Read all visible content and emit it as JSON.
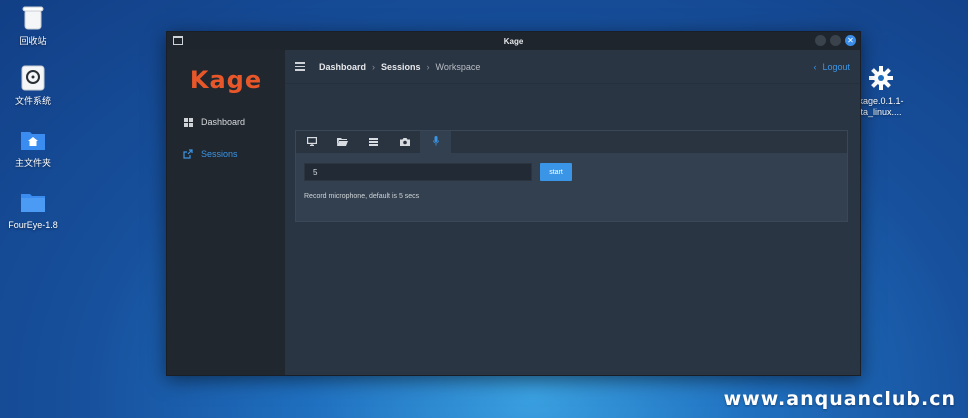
{
  "desktop": {
    "icons": [
      {
        "label": "回收站",
        "icon": "trash-icon"
      },
      {
        "label": "文件系统",
        "icon": "drive-icon"
      },
      {
        "label": "主文件夹",
        "icon": "home-folder-icon"
      },
      {
        "label": "FourEye-1.8",
        "icon": "folder-icon"
      },
      {
        "label": "kage.0.1.1-\nta_linux....",
        "label_line1": "kage.0.1.1-",
        "label_line2": "ta_linux....",
        "icon": "gear-icon"
      }
    ]
  },
  "window": {
    "title": "Kage",
    "brand": "Kage",
    "sidebar": {
      "items": [
        {
          "label": "Dashboard",
          "icon": "grid-icon",
          "active": false
        },
        {
          "label": "Sessions",
          "icon": "share-icon",
          "active": true
        }
      ]
    },
    "breadcrumb": [
      "Dashboard",
      "Sessions",
      "Workspace"
    ],
    "logout_label": "Logout",
    "tabs": [
      {
        "icon": "monitor-icon",
        "active": false
      },
      {
        "icon": "folder-open-icon",
        "active": false
      },
      {
        "icon": "list-icon",
        "active": false
      },
      {
        "icon": "camera-icon",
        "active": false
      },
      {
        "icon": "microphone-icon",
        "active": true
      }
    ],
    "duration_value": "5",
    "start_label": "start",
    "help_text": "Record microphone, default is 5 secs"
  },
  "colors": {
    "accent": "#3b95e6",
    "brand": "#e8572a",
    "sidebar_bg": "#20272f",
    "main_bg": "#2a3544"
  },
  "watermark": "www.anquanclub.cn"
}
